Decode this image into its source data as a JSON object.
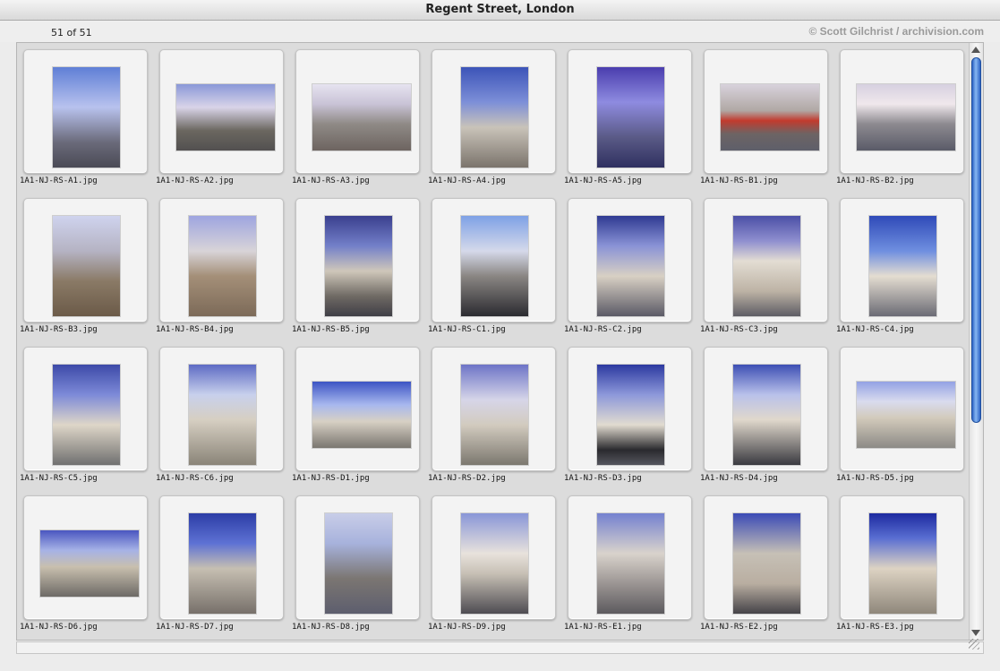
{
  "window": {
    "title": "Regent Street, London",
    "count": "51 of 51",
    "credit": "© Scott Gilchrist / archivision.com"
  },
  "thumbnails": [
    {
      "filename": "1A1-NJ-RS-A1.jpg",
      "orientation": "portrait"
    },
    {
      "filename": "1A1-NJ-RS-A2.jpg",
      "orientation": "landscape"
    },
    {
      "filename": "1A1-NJ-RS-A3.jpg",
      "orientation": "landscape"
    },
    {
      "filename": "1A1-NJ-RS-A4.jpg",
      "orientation": "portrait"
    },
    {
      "filename": "1A1-NJ-RS-A5.jpg",
      "orientation": "portrait"
    },
    {
      "filename": "1A1-NJ-RS-B1.jpg",
      "orientation": "landscape"
    },
    {
      "filename": "1A1-NJ-RS-B2.jpg",
      "orientation": "landscape"
    },
    {
      "filename": "1A1-NJ-RS-B3.jpg",
      "orientation": "portrait"
    },
    {
      "filename": "1A1-NJ-RS-B4.jpg",
      "orientation": "portrait"
    },
    {
      "filename": "1A1-NJ-RS-B5.jpg",
      "orientation": "portrait"
    },
    {
      "filename": "1A1-NJ-RS-C1.jpg",
      "orientation": "portrait"
    },
    {
      "filename": "1A1-NJ-RS-C2.jpg",
      "orientation": "portrait"
    },
    {
      "filename": "1A1-NJ-RS-C3.jpg",
      "orientation": "portrait"
    },
    {
      "filename": "1A1-NJ-RS-C4.jpg",
      "orientation": "portrait"
    },
    {
      "filename": "1A1-NJ-RS-C5.jpg",
      "orientation": "portrait"
    },
    {
      "filename": "1A1-NJ-RS-C6.jpg",
      "orientation": "portrait"
    },
    {
      "filename": "1A1-NJ-RS-D1.jpg",
      "orientation": "landscape"
    },
    {
      "filename": "1A1-NJ-RS-D2.jpg",
      "orientation": "portrait"
    },
    {
      "filename": "1A1-NJ-RS-D3.jpg",
      "orientation": "portrait"
    },
    {
      "filename": "1A1-NJ-RS-D4.jpg",
      "orientation": "portrait"
    },
    {
      "filename": "1A1-NJ-RS-D5.jpg",
      "orientation": "landscape"
    },
    {
      "filename": "1A1-NJ-RS-D6.jpg",
      "orientation": "landscape"
    },
    {
      "filename": "1A1-NJ-RS-D7.jpg",
      "orientation": "portrait"
    },
    {
      "filename": "1A1-NJ-RS-D8.jpg",
      "orientation": "portrait"
    },
    {
      "filename": "1A1-NJ-RS-D9.jpg",
      "orientation": "portrait"
    },
    {
      "filename": "1A1-NJ-RS-E1.jpg",
      "orientation": "portrait"
    },
    {
      "filename": "1A1-NJ-RS-E2.jpg",
      "orientation": "portrait"
    },
    {
      "filename": "1A1-NJ-RS-E3.jpg",
      "orientation": "portrait"
    }
  ],
  "scrollbar": {
    "position_fraction": 0.0,
    "visible_fraction": 0.62
  }
}
